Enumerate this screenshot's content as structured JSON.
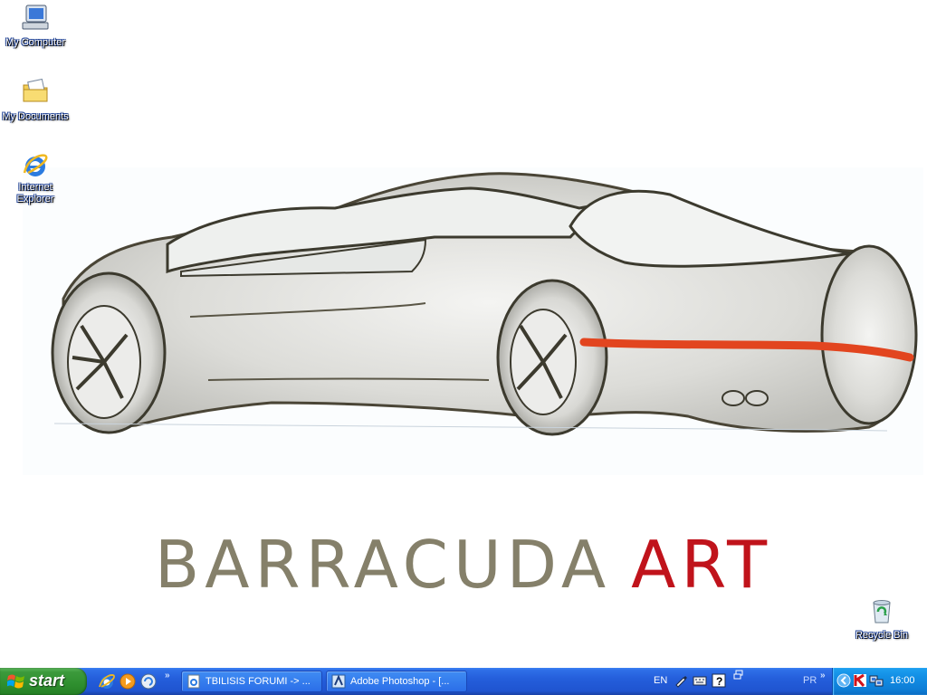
{
  "wallpaper": {
    "brand_word1": "BARRACUDA",
    "brand_word2": "ART",
    "brand_color_gray": "#85806a",
    "brand_color_red": "#c0131b"
  },
  "desktop_icons": {
    "my_computer": "My Computer",
    "my_documents": "My Documents",
    "internet_explorer_line1": "Internet",
    "internet_explorer_line2": "Explorer",
    "recycle_bin": "Recycle Bin"
  },
  "taskbar": {
    "start_label": "start",
    "quick_launch_icons": [
      "internet-explorer-icon",
      "media-player-icon",
      "show-desktop-icon"
    ],
    "tasks": [
      {
        "label": "TBILISIS FORUMI -> ...",
        "icon": "ie-page-icon"
      },
      {
        "label": "Adobe Photoshop - [...",
        "icon": "photoshop-icon"
      }
    ],
    "language": "EN",
    "toolbar_label": "PR",
    "clock": "16:00",
    "colors": {
      "taskbar_blue": "#245edb",
      "start_green": "#3c9a3c",
      "tray_blue": "#0f86dc"
    }
  }
}
